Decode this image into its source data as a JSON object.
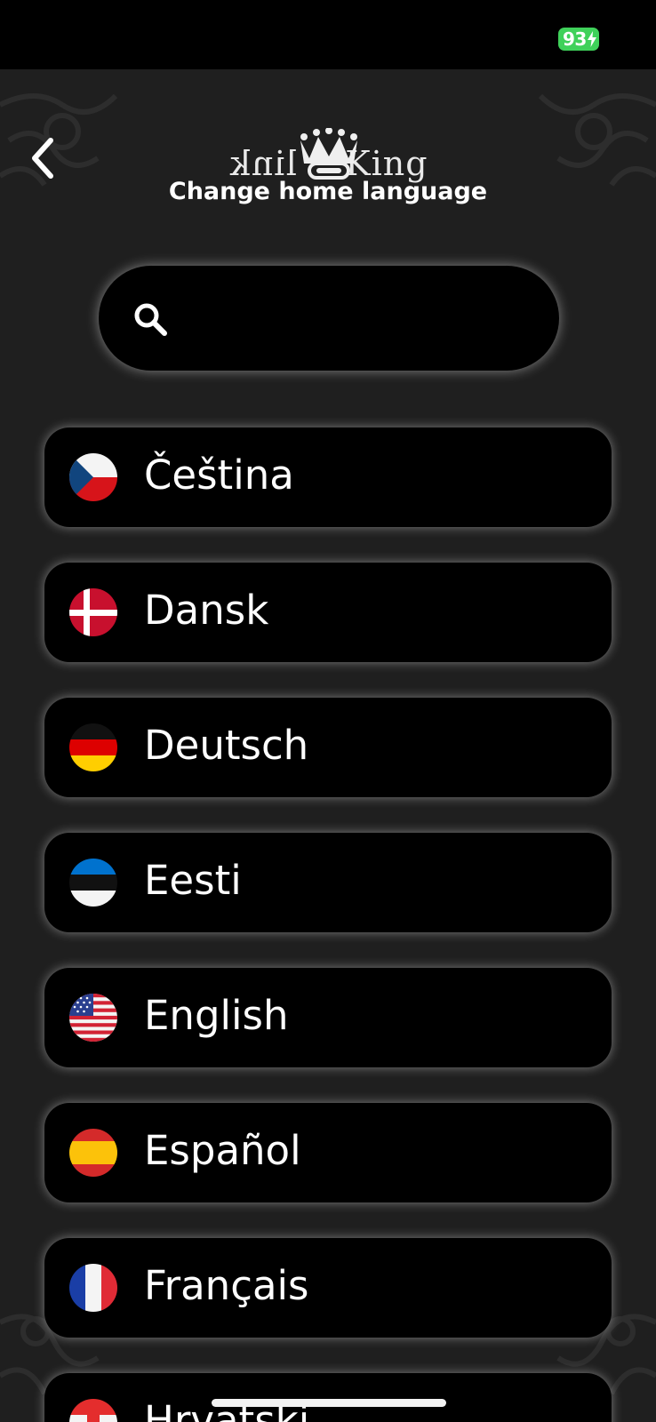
{
  "status_bar": {
    "battery_level": "93"
  },
  "header": {
    "back_icon": "chevron-left-icon",
    "logo": {
      "left": "link",
      "right": "King"
    },
    "title": "Change home language"
  },
  "search": {
    "icon": "search-icon",
    "value": "",
    "placeholder": ""
  },
  "languages": [
    {
      "label": "Čeština",
      "flag": "czech-flag-icon"
    },
    {
      "label": "Dansk",
      "flag": "danish-flag-icon"
    },
    {
      "label": "Deutsch",
      "flag": "german-flag-icon"
    },
    {
      "label": "Eesti",
      "flag": "estonian-flag-icon"
    },
    {
      "label": "English",
      "flag": "us-flag-icon"
    },
    {
      "label": "Español",
      "flag": "spanish-flag-icon"
    },
    {
      "label": "Français",
      "flag": "french-flag-icon"
    },
    {
      "label": "Hrvatski",
      "flag": "croatian-flag-icon"
    }
  ],
  "colors": {
    "background": "#1f1f1f",
    "card": "#000000",
    "text": "#ffffff",
    "battery": "#3fd15a"
  }
}
